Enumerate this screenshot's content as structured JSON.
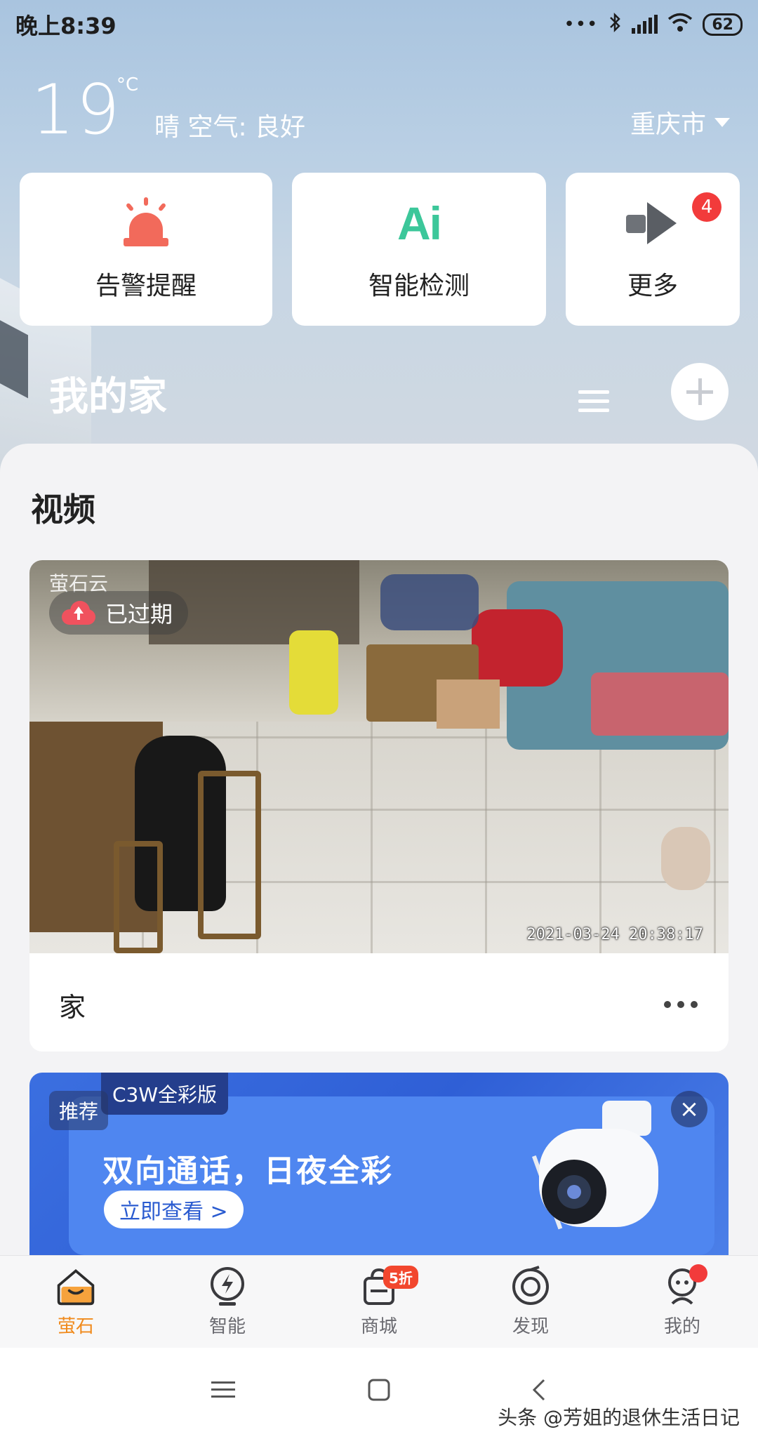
{
  "status_bar": {
    "time": "晚上8:39",
    "battery": "62"
  },
  "weather": {
    "temperature": "19",
    "unit": "°C",
    "description": "晴 空气: 良好",
    "city": "重庆市"
  },
  "quick_actions": [
    {
      "label": "告警提醒",
      "icon": "alarm-siren-icon"
    },
    {
      "label": "智能检测",
      "icon": "ai-icon",
      "icon_text": "Ai"
    },
    {
      "label": "更多",
      "icon": "more-arrow-icon",
      "badge": "4"
    }
  ],
  "home": {
    "title": "我的家"
  },
  "videos": {
    "section_title": "视频",
    "camera": {
      "logo_text": "萤石云",
      "status": "已过期",
      "timestamp": "2021-03-24 20:38:17",
      "name": "家"
    }
  },
  "promo": {
    "ribbon": "C3W全彩版",
    "tag": "推荐",
    "headline": "双向通话，日夜全彩",
    "cta": "立即查看 >",
    "close": "×"
  },
  "bottom_nav": [
    {
      "label": "萤石",
      "active": true
    },
    {
      "label": "智能"
    },
    {
      "label": "商城",
      "badge": "5折"
    },
    {
      "label": "发现"
    },
    {
      "label": "我的",
      "dot": true
    }
  ],
  "watermark": "头条 @芳姐的退休生活日记",
  "colors": {
    "accent": "#f08a1c",
    "alarm": "#f26a5b",
    "ai": "#3cc79a",
    "badge": "#f23b3b"
  }
}
